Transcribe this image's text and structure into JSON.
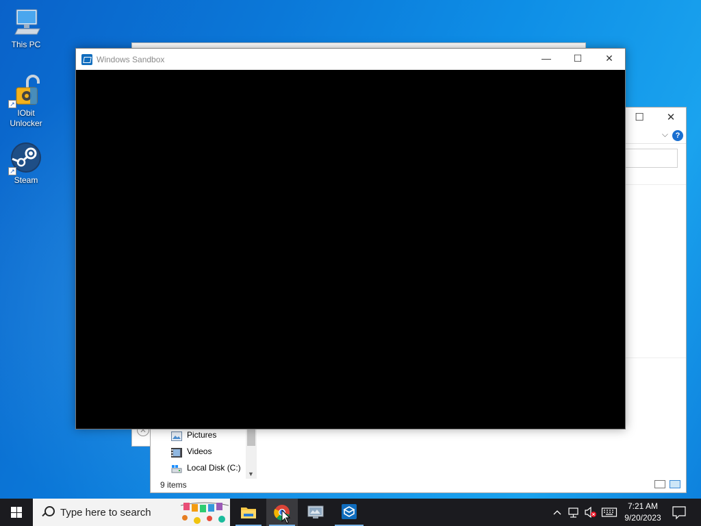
{
  "desktop": {
    "icons": [
      {
        "label": "This PC",
        "icon": "computer-icon"
      },
      {
        "label": "IObit\nUnlocker",
        "icon": "iobit-unlocker-icon"
      },
      {
        "label": "Steam",
        "icon": "steam-icon"
      }
    ]
  },
  "sandbox_window": {
    "title": "Windows Sandbox",
    "minimize": "—",
    "maximize": "☐",
    "close": "✕"
  },
  "explorer_window": {
    "maximize": "☐",
    "close": "✕",
    "help": "?",
    "nav_items": [
      {
        "label": "Pictures",
        "icon": "pictures-folder-icon"
      },
      {
        "label": "Videos",
        "icon": "videos-folder-icon"
      },
      {
        "label": "Local Disk (C:)",
        "icon": "local-disk-icon"
      }
    ],
    "status": "9 items"
  },
  "taskbar": {
    "search_placeholder": "Type here to search",
    "apps": [
      {
        "name": "File Explorer",
        "icon": "file-explorer-icon"
      },
      {
        "name": "Google Chrome",
        "icon": "chrome-icon"
      },
      {
        "name": "Virtual machine app",
        "icon": "vm-app-icon"
      },
      {
        "name": "Windows Sandbox",
        "icon": "windows-sandbox-icon"
      }
    ],
    "clock_time": "7:21 AM",
    "clock_date": "9/20/2023"
  },
  "colors": {
    "accent": "#0078d4",
    "taskbar": "#1b1b1f",
    "sandbox_content": "#000000"
  }
}
